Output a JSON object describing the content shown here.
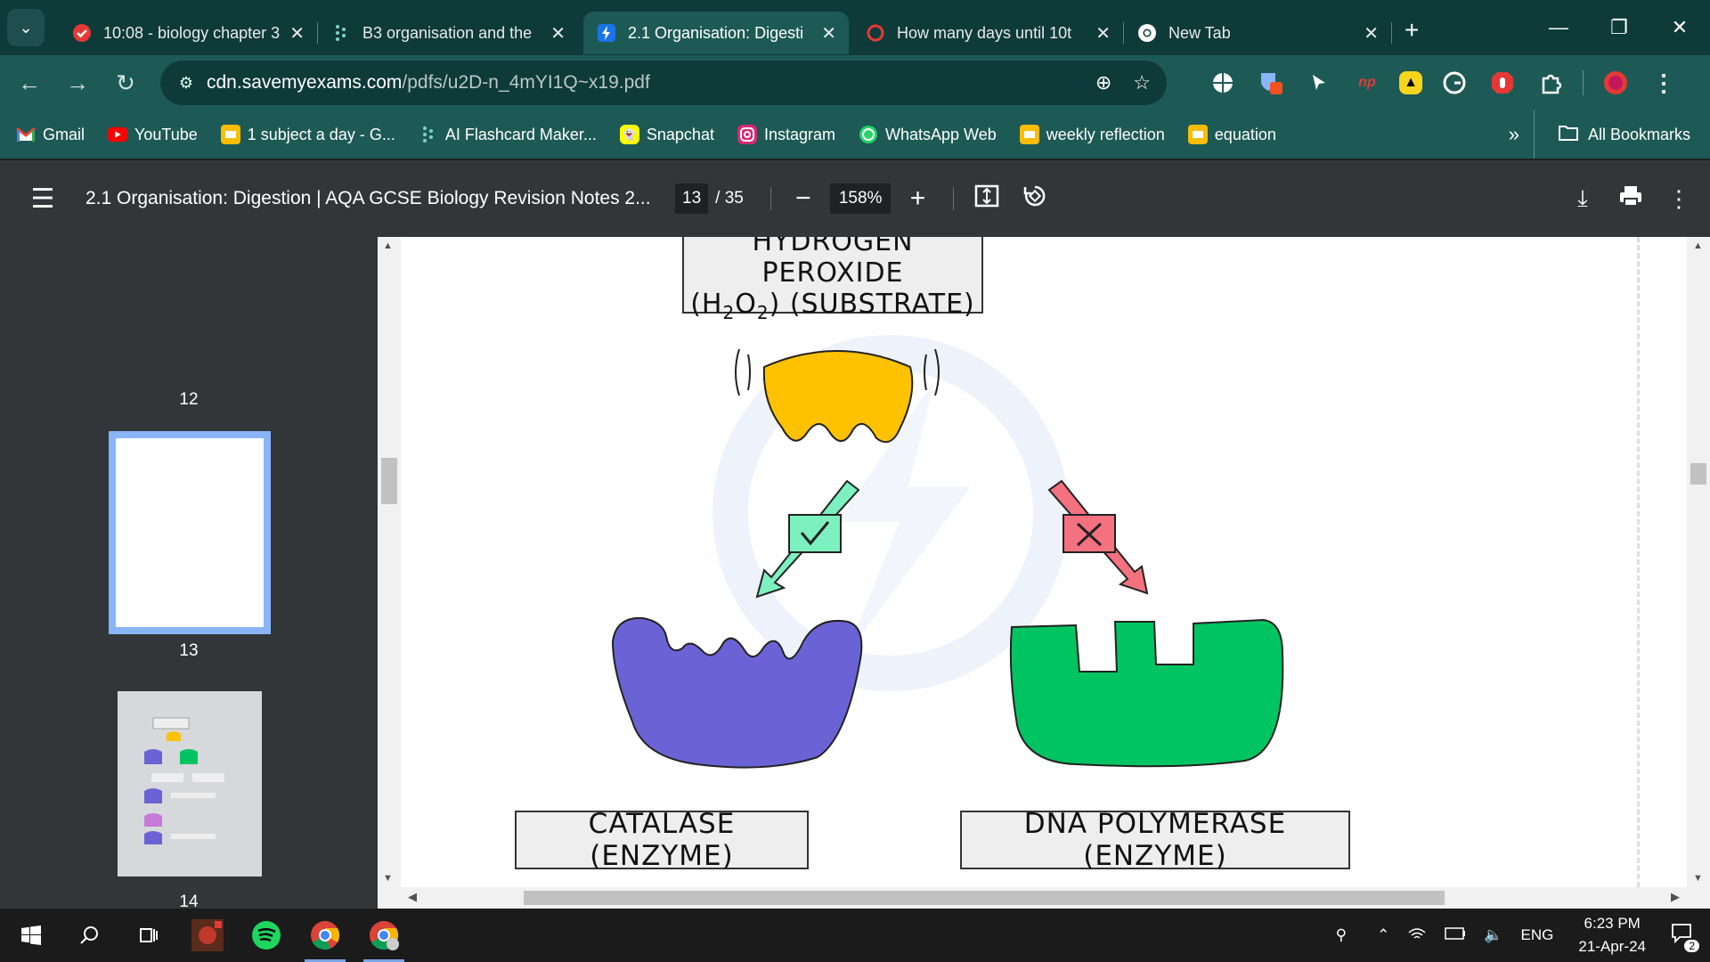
{
  "tabs": [
    {
      "title": "10:08 - biology chapter 3",
      "favicon": "check-circle-icon",
      "color": "#e53935"
    },
    {
      "title": "B3 organisation and the",
      "favicon": "dots-grid-icon",
      "color": "#7fd4c3"
    },
    {
      "title": "2.1 Organisation: Digesti",
      "favicon": "bolt-icon",
      "color": "#1a73e8",
      "active": true
    },
    {
      "title": "How many days until 10t",
      "favicon": "timer-icon",
      "color": "#e53935"
    },
    {
      "title": "New Tab",
      "favicon": "chrome-icon",
      "color": "#ffffff"
    }
  ],
  "address": {
    "domain": "cdn.savemyexams.com",
    "path": "/pdfs/u2D-n_4mYI1Q~x19.pdf"
  },
  "bookmarks": [
    {
      "label": "Gmail",
      "icon": "gmail-icon",
      "color": "#ea4335"
    },
    {
      "label": "YouTube",
      "icon": "youtube-icon",
      "color": "#ff0000"
    },
    {
      "label": "1 subject a day - G...",
      "icon": "slides-icon",
      "color": "#fbbc04"
    },
    {
      "label": "AI Flashcard Maker...",
      "icon": "dots-grid-icon",
      "color": "#7fd4c3"
    },
    {
      "label": "Snapchat",
      "icon": "snapchat-icon",
      "color": "#fffc00"
    },
    {
      "label": "Instagram",
      "icon": "instagram-icon",
      "color": "#d62976"
    },
    {
      "label": "WhatsApp Web",
      "icon": "whatsapp-icon",
      "color": "#25d366"
    },
    {
      "label": "weekly reflection",
      "icon": "slides-icon",
      "color": "#fbbc04"
    },
    {
      "label": "equation",
      "icon": "slides-icon",
      "color": "#fbbc04"
    }
  ],
  "bookmarks_more": "»",
  "all_bookmarks": "All Bookmarks",
  "pdf": {
    "title": "2.1 Organisation: Digestion | AQA GCSE Biology Revision Notes 2...",
    "page": "13",
    "total": "/ 35",
    "zoom": "158%",
    "thumb_labels": [
      "12",
      "13",
      "14"
    ]
  },
  "diagram": {
    "substrate_line1": "HYDROGEN  PEROXIDE",
    "substrate_line2_pre": "(H",
    "substrate_sub1": "2",
    "substrate_mid": "O",
    "substrate_sub2": "2",
    "substrate_post": ")  (SUBSTRATE)",
    "enzyme_left": "CATALASE  (ENZYME)",
    "enzyme_right": "DNA  POLYMERASE  (ENZYME)",
    "colors": {
      "substrate": "#fec200",
      "catalase": "#6b63d5",
      "polymerase": "#00c462",
      "tick_box": "#7df0c0",
      "cross_box": "#f4717f"
    }
  },
  "taskbar": {
    "apps": [
      "windows-start-icon",
      "search-icon",
      "task-view-icon",
      "game-app-icon",
      "spotify-icon",
      "chrome-icon",
      "chrome-profile-icon"
    ],
    "language": "ENG",
    "time": "6:23 PM",
    "date": "21-Apr-24",
    "notifications": "2"
  }
}
